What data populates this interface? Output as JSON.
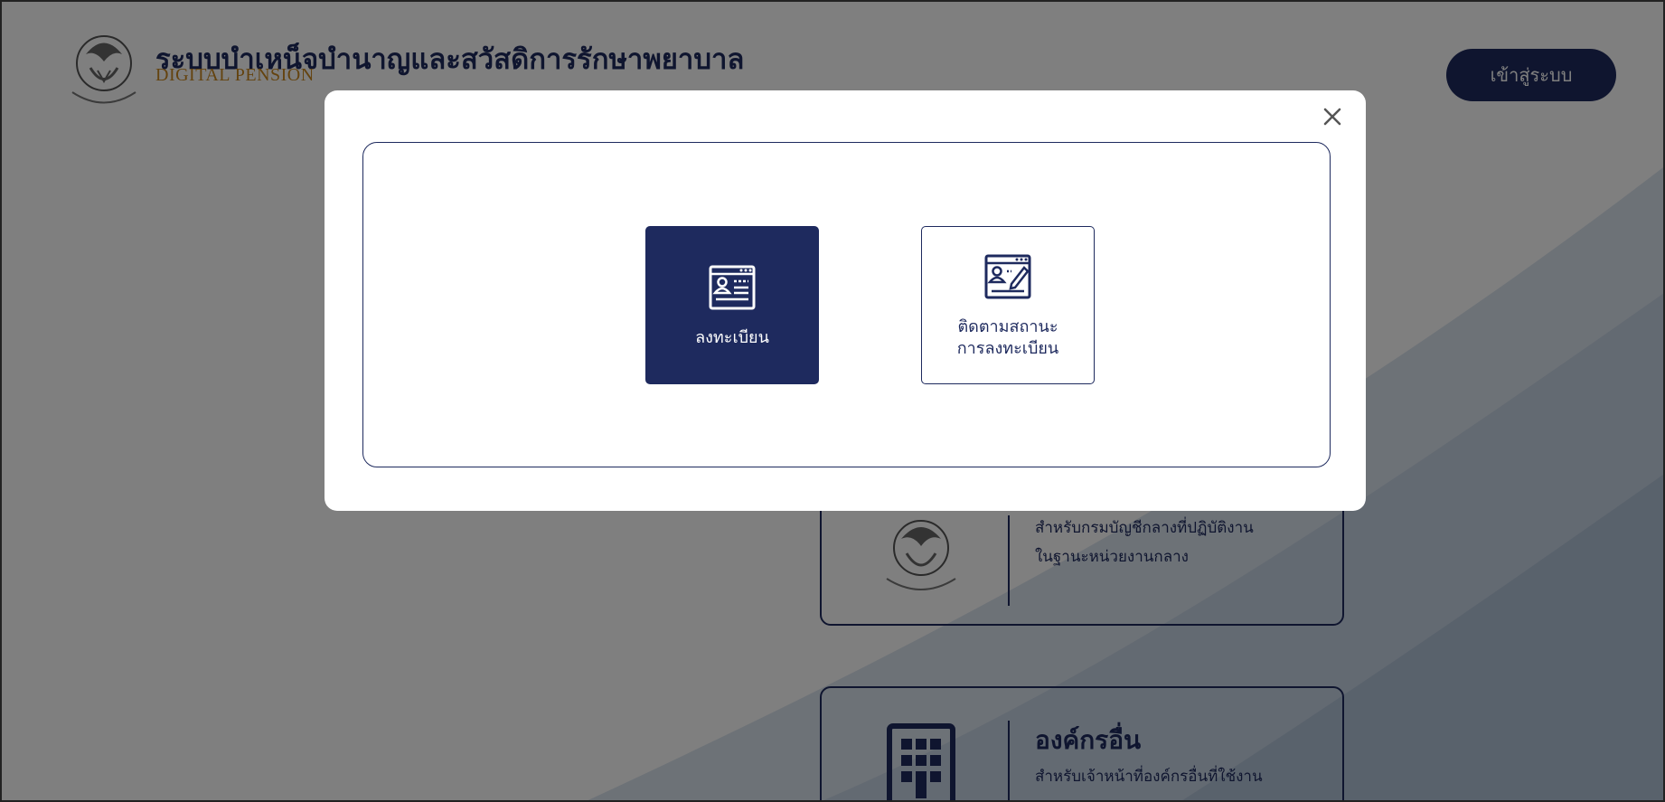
{
  "header": {
    "title": "ระบบบำเหน็จบำนาญและสวัสดิการรักษาพยาบาล",
    "subtitle": "DIGITAL PENSION",
    "login_label": "เข้าสู่ระบบ",
    "logo_icon": "garuda-seal-icon"
  },
  "cards": [
    {
      "icon": "garuda-seal-icon",
      "title": "",
      "desc_line1": "สำหรับกรมบัญชีกลางที่ปฏิบัติงาน",
      "desc_line2": "ในฐานะหน่วยงานกลาง"
    },
    {
      "icon": "building-icon",
      "title": "องค์กรอื่น",
      "desc_line1": "สำหรับเจ้าหน้าที่องค์กรอื่นที่ใช้งาน",
      "desc_line2": ""
    }
  ],
  "modal": {
    "close_icon": "close-icon",
    "options": [
      {
        "icon": "registration-form-icon",
        "label": "ลงทะเบียน"
      },
      {
        "icon": "edit-form-icon",
        "label_line1": "ติดตามสถานะ",
        "label_line2": "การลงทะเบียน"
      }
    ]
  },
  "colors": {
    "primary": "#1e2a5e",
    "accent": "#c9871e",
    "overlay": "rgba(0,0,0,0.5)"
  }
}
